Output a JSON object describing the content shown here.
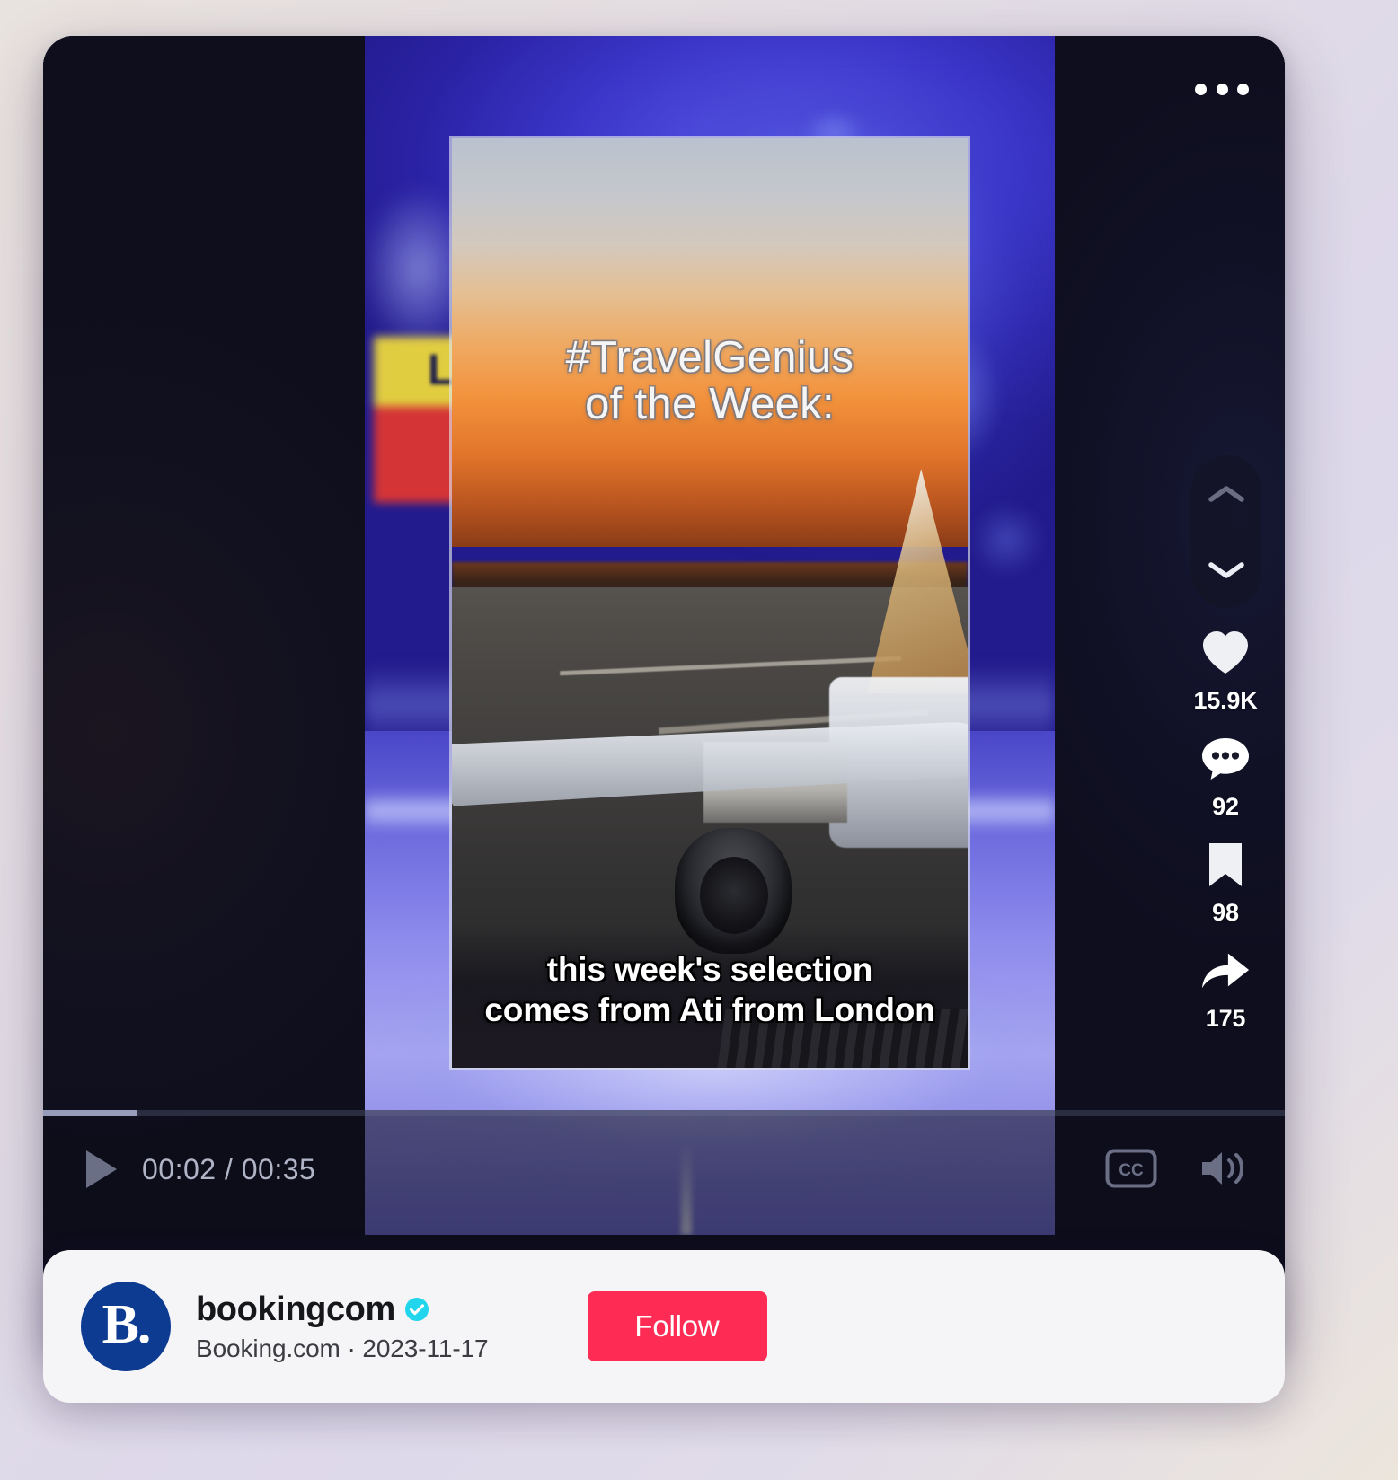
{
  "player": {
    "more_menu_label": "More options",
    "overlay_title_lines": [
      "#TravelGenius",
      "of the Week:"
    ],
    "subtitle_lines": [
      "this week's selection",
      "comes from Ati from London"
    ]
  },
  "nav": {
    "prev_label": "Previous video",
    "next_label": "Next video"
  },
  "actions": [
    {
      "icon": "heart-icon",
      "name": "like",
      "count": "15.9K"
    },
    {
      "icon": "comment-icon",
      "name": "comment",
      "count": "92"
    },
    {
      "icon": "bookmark-icon",
      "name": "bookmark",
      "count": "98"
    },
    {
      "icon": "share-icon",
      "name": "share",
      "count": "175"
    }
  ],
  "controls": {
    "play_label": "Play",
    "current_time": "00:02",
    "separator": "/",
    "duration": "00:35",
    "time_display": "00:02 / 00:35",
    "progress_percent": 7.5,
    "captions_label": "CC",
    "volume_label": "Volume"
  },
  "author": {
    "avatar_mark": "B.",
    "username": "bookingcom",
    "verified": true,
    "display_name": "Booking.com",
    "separator": "·",
    "date": "2023-11-17",
    "meta_line": "Booking.com · 2023-11-17",
    "follow_label": "Follow"
  },
  "colors": {
    "accent_follow": "#fe2c55",
    "verified_badge": "#20d5ec",
    "avatar_bg": "#0c3b91",
    "author_bar_bg": "#f5f4f6"
  },
  "backdrop": {
    "lower_third_letter": "L"
  }
}
